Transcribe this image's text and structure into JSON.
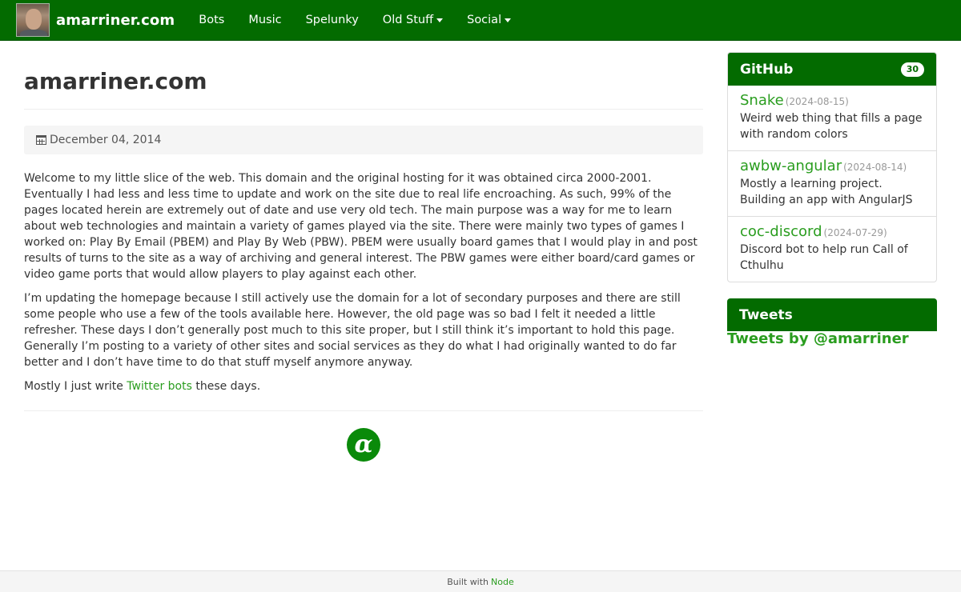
{
  "navbar": {
    "brand": "amarriner.com",
    "items": [
      {
        "label": "Bots",
        "dropdown": false
      },
      {
        "label": "Music",
        "dropdown": false
      },
      {
        "label": "Spelunky",
        "dropdown": false
      },
      {
        "label": "Old Stuff",
        "dropdown": true
      },
      {
        "label": "Social",
        "dropdown": true
      }
    ]
  },
  "main": {
    "title": "amarriner.com",
    "date": "December 04, 2014",
    "paragraphs": [
      "Welcome to my little slice of the web. This domain and the original hosting for it was obtained circa 2000-2001. Eventually I had less and less time to update and work on the site due to real life encroaching. As such, 99% of the pages located herein are extremely out of date and use very old tech. The main purpose was a way for me to learn about web technologies and maintain a variety of games played via the site. There were mainly two types of games I worked on: Play By Email (PBEM) and Play By Web (PBW). PBEM were usually board games that I would play in and post results of turns to the site as a way of archiving and general interest. The PBW games were either board/card games or video game ports that would allow players to play against each other.",
      "I’m updating the homepage because I still actively use the domain for a lot of secondary purposes and there are still some people who use a few of the tools available here. However, the old page was so bad I felt it needed a little refresher. These days I don’t generally post much to this site proper, but I still think it’s important to hold this page. Generally I’m posting to a variety of other sites and social services as they do what I had originally wanted to do far better and I don’t have time to do that stuff myself anymore anyway."
    ],
    "last_paragraph": {
      "before": "Mostly I just write ",
      "link": "Twitter bots",
      "after": " these days."
    },
    "badge_glyph": "α"
  },
  "sidebar": {
    "github": {
      "title": "GitHub",
      "count": "30",
      "repos": [
        {
          "name": "Snake",
          "date": "(2024-08-15)",
          "desc": "Weird web thing that fills a page with random colors"
        },
        {
          "name": "awbw-angular",
          "date": "(2024-08-14)",
          "desc": "Mostly a learning project. Building an app with AngularJS"
        },
        {
          "name": "coc-discord",
          "date": "(2024-07-29)",
          "desc": "Discord bot to help run Call of Cthulhu"
        }
      ]
    },
    "tweets": {
      "title": "Tweets",
      "link": "Tweets by @amarriner"
    }
  },
  "footer": {
    "text": "Built with",
    "link": "Node"
  },
  "colors": {
    "brand_green": "#036b00",
    "link_green": "#2a9d1f"
  }
}
